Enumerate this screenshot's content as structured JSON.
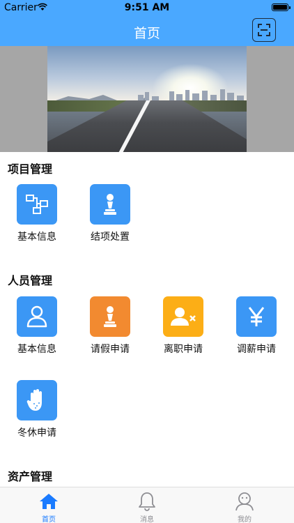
{
  "status_bar": {
    "carrier": "Carrier",
    "time": "9:51 AM"
  },
  "nav": {
    "title": "首页",
    "scan_icon": "qr-scan-icon"
  },
  "colors": {
    "header": "#4aa8ff",
    "tile_blue": "#3b97f5",
    "tile_orange": "#f28a30",
    "tile_amber": "#fcae16",
    "tab_active": "#1a7bff"
  },
  "sections": {
    "project": {
      "title": "项目管理",
      "items": [
        {
          "label": "基本信息",
          "icon": "flowchart-icon"
        },
        {
          "label": "结项处置",
          "icon": "chess-pawn-icon"
        }
      ]
    },
    "personnel": {
      "title": "人员管理",
      "items": [
        {
          "label": "基本信息",
          "icon": "person-icon"
        },
        {
          "label": "请假申请",
          "icon": "chess-pawn-icon"
        },
        {
          "label": "离职申请",
          "icon": "user-remove-icon"
        },
        {
          "label": "调薪申请",
          "icon": "yen-icon"
        },
        {
          "label": "冬休申请",
          "icon": "hand-icon"
        }
      ]
    },
    "assets": {
      "title": "资产管理"
    }
  },
  "tabbar": {
    "items": [
      {
        "label": "首页",
        "icon": "home-icon",
        "active": true
      },
      {
        "label": "消息",
        "icon": "bell-icon",
        "active": false
      },
      {
        "label": "我的",
        "icon": "profile-icon",
        "active": false
      }
    ]
  }
}
